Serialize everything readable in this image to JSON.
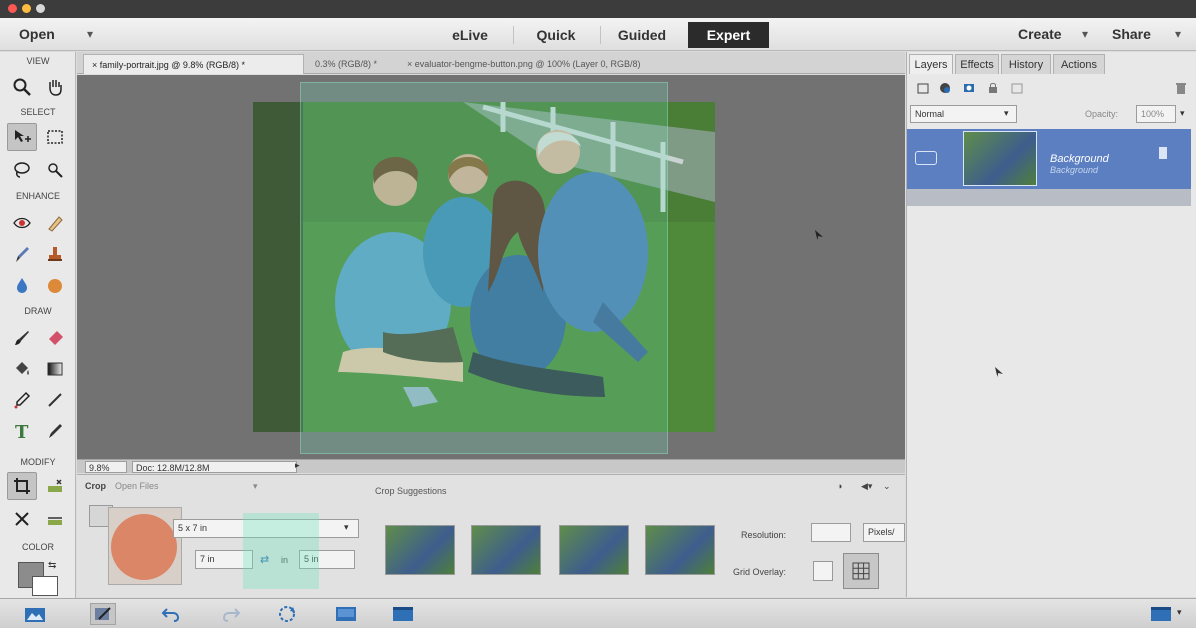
{
  "menubar": {
    "open_label": "Open",
    "modes": [
      "eLive",
      "Quick",
      "Guided",
      "Expert"
    ],
    "active_mode": "Expert",
    "create_label": "Create",
    "share_label": "Share"
  },
  "toolbox": {
    "sections": {
      "view": "VIEW",
      "select": "SELECT",
      "enhance": "ENHANCE",
      "draw": "DRAW",
      "modify": "MODIFY",
      "color": "COLOR"
    }
  },
  "document_tabs": [
    "family-portrait.jpg @ 9.8% (RGB/8) *",
    "0.3% (RGB/8) *",
    "evaluator-bengme-button.png @ 100% (Layer 0, RGB/8)"
  ],
  "status": {
    "zoom": "9.8%",
    "doc": "Doc: 12.8M/12.8M"
  },
  "options": {
    "tool_name": "Crop",
    "open_files": "Open Files",
    "crop_suggestions": "Crop Suggestions",
    "preset": "5 x 7 in",
    "width": "7 in",
    "swap": "⇄",
    "in_label": "in",
    "height": "5 in",
    "resolution_label": "Resolution:",
    "resolution_unit": "Pixels/",
    "grid_overlay_label": "Grid Overlay:"
  },
  "layers_panel": {
    "tabs": [
      "Layers",
      "Effects",
      "History",
      "Actions"
    ],
    "active_tab": "Layers",
    "blend_mode": "Normal",
    "opacity_label": "Opacity:",
    "opacity_value": "100%",
    "layers": [
      {
        "name": "Background",
        "sub": "Background"
      }
    ]
  },
  "colors": {
    "active_mode_bg": "#2b2b2b",
    "layer_selected": "#5b7fc1",
    "canvas_bg": "#727272"
  },
  "icons": [
    "zoom-icon",
    "hand-icon",
    "move-icon",
    "marquee-icon",
    "lasso-icon",
    "quick-selection-icon",
    "red-eye-icon",
    "spot-healing-icon",
    "smart-brush-icon",
    "clone-stamp-icon",
    "blur-icon",
    "sponge-icon",
    "brush-icon",
    "eraser-icon",
    "paint-bucket-icon",
    "gradient-icon",
    "eyedropper-icon",
    "pencil-icon",
    "type-icon",
    "color-replace-icon",
    "crop-icon",
    "recompose-icon",
    "content-aware-move-icon",
    "straighten-icon"
  ]
}
